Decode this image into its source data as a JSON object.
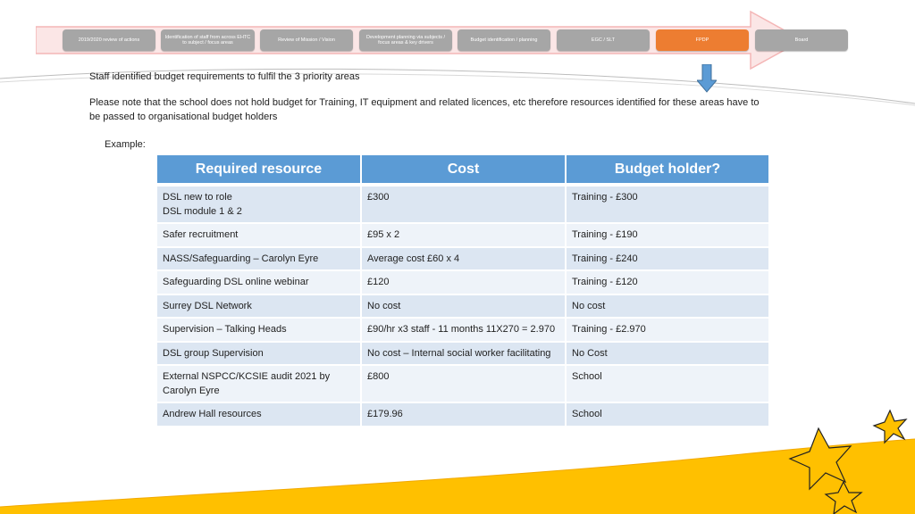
{
  "process_steps": [
    {
      "label": "2019/2020 review of actions",
      "active": false
    },
    {
      "label": "Identification of staff from across EHTC to subject / focus areas",
      "active": false
    },
    {
      "label": "Review of Mission / Vision",
      "active": false
    },
    {
      "label": "Development planning via subjects / focus areas & key drivers",
      "active": false
    },
    {
      "label": "Budget identification / planning",
      "active": false
    },
    {
      "label": "EGC / SLT",
      "active": false
    },
    {
      "label": "FPDP",
      "active": true
    },
    {
      "label": "Board",
      "active": false
    }
  ],
  "intro": "Staff identified budget requirements to fulfil the 3 priority areas",
  "note": "Please note that the school does not hold budget for Training, IT equipment and related licences, etc therefore resources identified for these areas have to be passed to organisational budget holders",
  "example_label": "Example:",
  "table": {
    "headers": [
      "Required resource",
      "Cost",
      "Budget holder?"
    ],
    "rows": [
      [
        "DSL new to role\nDSL module 1 & 2",
        "£300",
        "Training  - £300"
      ],
      [
        "Safer recruitment",
        "£95 x 2",
        "Training  - £190"
      ],
      [
        "NASS/Safeguarding  – Carolyn Eyre",
        "Average cost £60 x 4",
        "Training  - £240"
      ],
      [
        "Safeguarding DSL online webinar",
        "£120",
        "Training  - £120"
      ],
      [
        "Surrey DSL Network",
        "No cost",
        "No cost"
      ],
      [
        "Supervision – Talking Heads",
        "£90/hr x3 staff - 11 months 11X270 = 2.970",
        "Training  - £2.970"
      ],
      [
        "DSL group Supervision",
        "No cost – Internal social worker facilitating",
        "No Cost"
      ],
      [
        "External NSPCC/KCSIE  audit 2021 by Carolyn Eyre",
        "£800",
        "School"
      ],
      [
        "Andrew Hall resources",
        "£179.96",
        "School"
      ]
    ]
  },
  "colors": {
    "step_gray": "#a6a6a6",
    "step_active": "#ed7d31",
    "header_blue": "#5b9bd5",
    "row_even": "#dce6f2",
    "row_odd": "#eef3f9",
    "arrow_blue": "#5b9bd5",
    "star_yellow": "#ffc000"
  },
  "icons": [
    "down-arrow-icon",
    "star-icon"
  ]
}
